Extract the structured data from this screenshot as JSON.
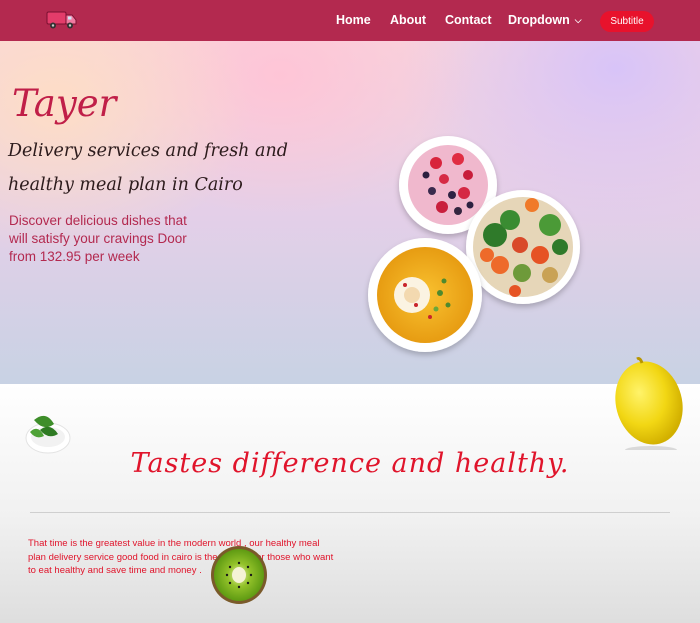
{
  "navbar": {
    "logo_icon": "delivery-truck-icon",
    "links": {
      "home": "Home",
      "about": "About",
      "contact": "Contact",
      "dropdown": "Dropdown"
    },
    "subtitle_button": "Subtitle",
    "background": "#b3294f",
    "button_color": "#e8122c"
  },
  "hero": {
    "title": "Tayer",
    "tagline": "Delivery services and fresh and healthy meal plan in Cairo",
    "description": "Discover delicious dishes that will satisfy your cravings Door from 132.95 per week",
    "food_images": [
      "berry-yogurt-bowl-icon",
      "vegetable-salad-bowl-icon",
      "soup-bowl-icon"
    ]
  },
  "section": {
    "title": "Tastes difference and healthy.",
    "description": "That time is the greatest value in the modern world , our healthy meal plan delivery service good food in cairo is the answer for those who want to eat healthy and save time and money .",
    "decor_icons": [
      "lemon-icon",
      "basil-bowl-icon",
      "kiwi-icon"
    ],
    "accent": "#e0142b"
  }
}
